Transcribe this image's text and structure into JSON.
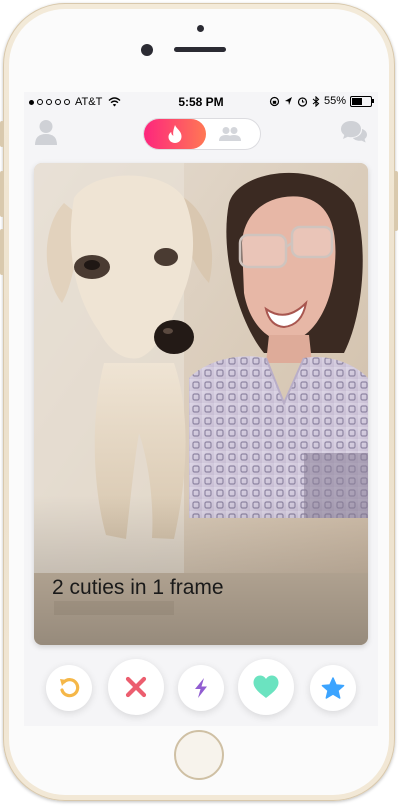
{
  "status_bar": {
    "carrier": "AT&T",
    "time": "5:58 PM",
    "battery_percent": "55%",
    "battery_level": 0.55,
    "signal_bars_filled": 1,
    "signal_bars_total": 5
  },
  "top_bar": {
    "profile_icon": "person-icon",
    "mode_active": "flame-icon",
    "mode_inactive": "group-icon",
    "messages_icon": "chat-bubbles-icon"
  },
  "card": {
    "caption": "2 cuties in 1 frame",
    "photo": "dog-and-woman-photo"
  },
  "actions": [
    {
      "name": "rewind-button",
      "icon": "rewind-icon",
      "color": "#f5b748"
    },
    {
      "name": "nope-button",
      "icon": "x-icon",
      "color": "#ec5e6f"
    },
    {
      "name": "boost-button",
      "icon": "lightning-icon",
      "color": "#915dd1"
    },
    {
      "name": "like-button",
      "icon": "heart-icon",
      "color": "#6be3c0"
    },
    {
      "name": "super-like-button",
      "icon": "star-icon",
      "color": "#3ca4ff"
    }
  ],
  "colors": {
    "brand_gradient_start": "#fd267d",
    "brand_gradient_end": "#ff7854"
  }
}
